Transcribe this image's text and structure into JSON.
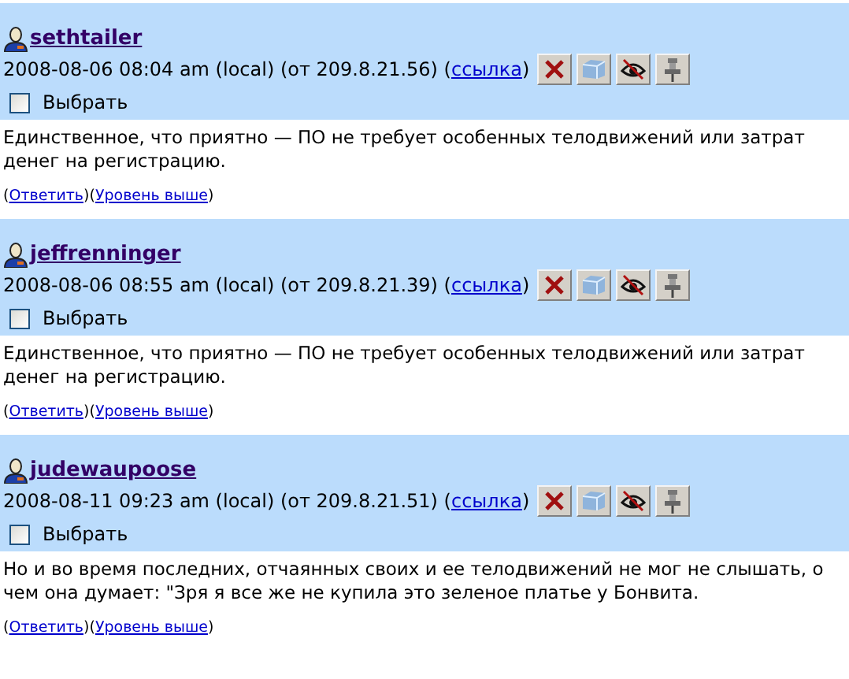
{
  "comments": [
    {
      "author": "sethtailer",
      "meta": "2008-08-06 08:04 am (local) (от 209.8.21.56) (",
      "link": "ссылка",
      "meta_end": ")",
      "select": {
        "label": "Выбрать",
        "checked": false
      },
      "body": "Единственное, что приятно — ПО не требует особенных телодвижений или затрат денег на регистрацию.",
      "footer": [
        {
          "kind": "text",
          "text": "("
        },
        {
          "kind": "link",
          "text": "Ответить"
        },
        {
          "kind": "text",
          "text": ")("
        },
        {
          "kind": "link",
          "text": "Уровень выше"
        },
        {
          "kind": "text",
          "text": ")"
        }
      ]
    },
    {
      "author": "jeffrenninger",
      "meta": "2008-08-06 08:55 am (local) (от 209.8.21.39) (",
      "link": "ссылка",
      "meta_end": ")",
      "select": {
        "label": "Выбрать",
        "checked": false
      },
      "body": "Единственное, что приятно — ПО не требует особенных телодвижений или затрат денег на регистрацию.",
      "footer": [
        {
          "kind": "text",
          "text": "("
        },
        {
          "kind": "link",
          "text": "Ответить"
        },
        {
          "kind": "text",
          "text": ")("
        },
        {
          "kind": "link",
          "text": "Уровень выше"
        },
        {
          "kind": "text",
          "text": ")"
        }
      ]
    },
    {
      "author": "judewaupoose",
      "meta": "2008-08-11 09:23 am (local) (от 209.8.21.51) (",
      "link": "ссылка",
      "meta_end": ")",
      "select": {
        "label": "Выбрать",
        "checked": false
      },
      "body": "Но и во время последних, отчаянных своих и ее телодвижений не мог не слышать, о чем она думает: \"Зря я все же не купила это зеленое платье у Бонвита.",
      "footer": [
        {
          "kind": "text",
          "text": "("
        },
        {
          "kind": "link",
          "text": "Ответить"
        },
        {
          "kind": "text",
          "text": ")("
        },
        {
          "kind": "link",
          "text": "Уровень выше"
        },
        {
          "kind": "text",
          "text": ")"
        }
      ]
    }
  ]
}
